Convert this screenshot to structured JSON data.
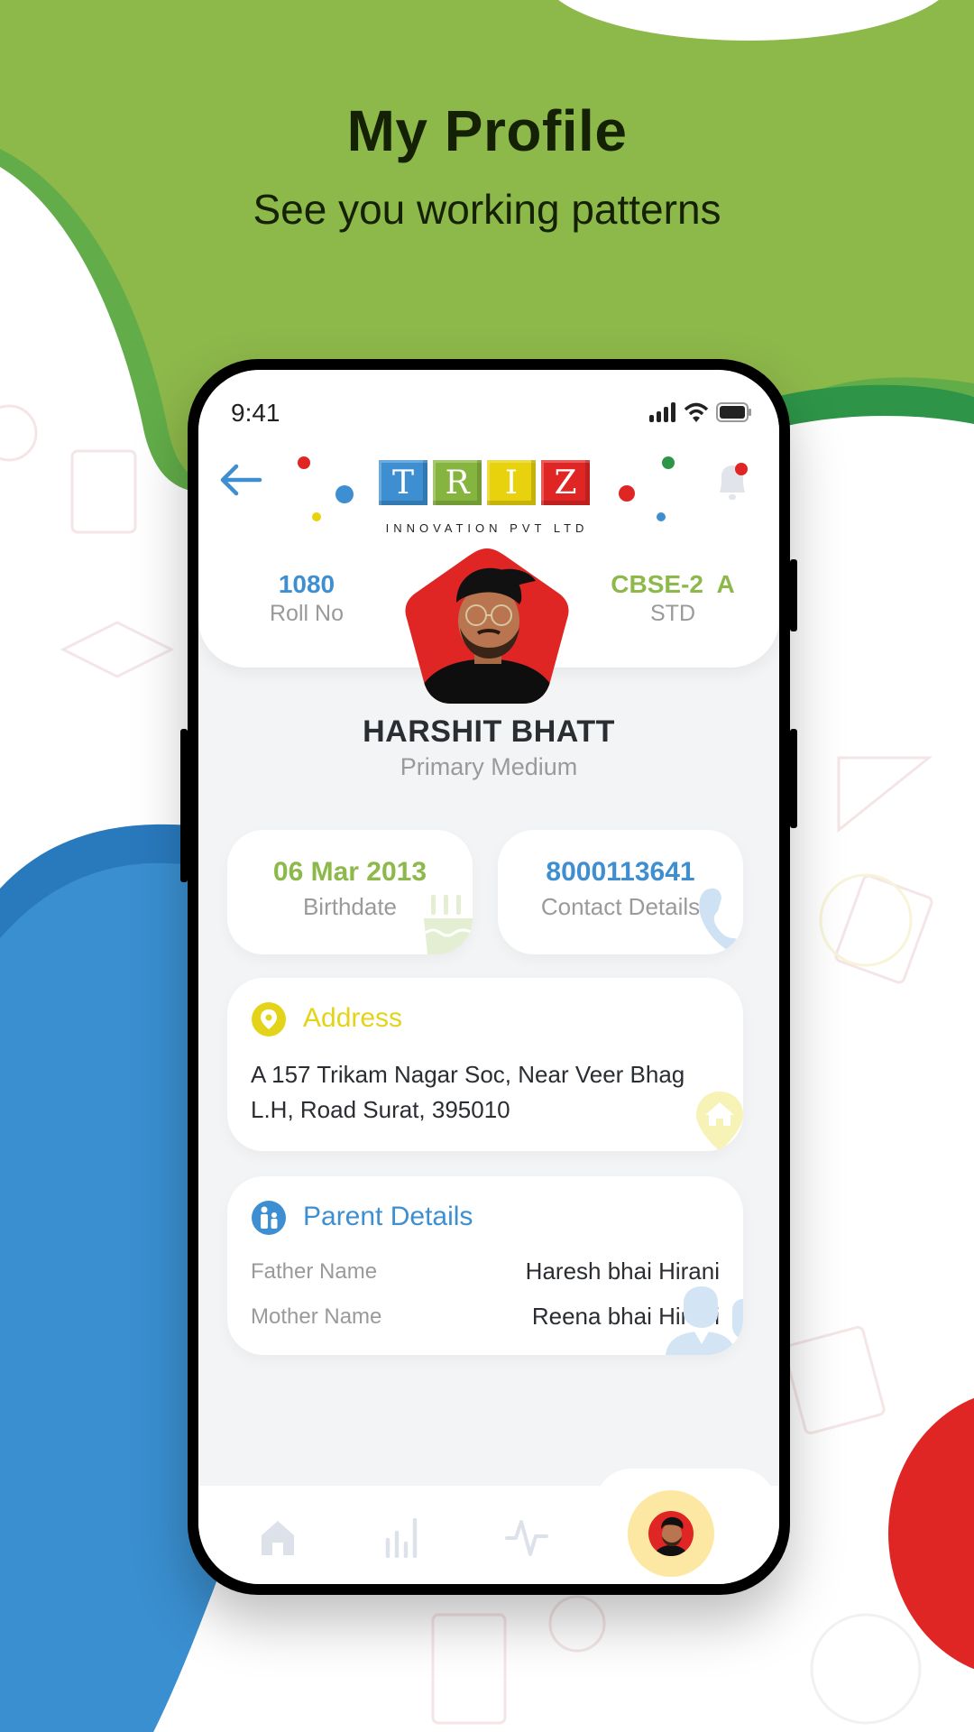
{
  "promo": {
    "title": "My Profile",
    "subtitle": "See you working patterns"
  },
  "status_bar": {
    "time": "9:41",
    "icons": [
      "signal-icon",
      "wifi-icon",
      "battery-icon"
    ]
  },
  "header": {
    "back_icon": "arrow-left-icon",
    "notification_icon": "bell-icon",
    "logo": {
      "letters": [
        "T",
        "R",
        "I",
        "Z"
      ],
      "letter_colors": [
        "#3d8fd1",
        "#86b53f",
        "#e8d20e",
        "#e02525"
      ],
      "subtitle": "INNOVATION PVT LTD"
    }
  },
  "profile": {
    "roll_no": {
      "value": "1080",
      "label": "Roll No"
    },
    "std": {
      "value": "CBSE-2  A",
      "label": "STD"
    },
    "name": "HARSHIT BHATT",
    "medium": "Primary Medium"
  },
  "info_cards": {
    "birthdate": {
      "value": "06 Mar 2013",
      "label": "Birthdate",
      "icon": "cake-icon"
    },
    "contact": {
      "value": "8000113641",
      "label": "Contact Details",
      "icon": "phone-icon"
    }
  },
  "address": {
    "title": "Address",
    "icon": "location-pin-icon",
    "line1": "A 157 Trikam Nagar Soc, Near Veer Bhag",
    "line2": "L.H, Road Surat, 395010"
  },
  "parents": {
    "title": "Parent Details",
    "icon": "family-icon",
    "rows": [
      {
        "label": "Father Name",
        "value": "Haresh bhai Hirani"
      },
      {
        "label": "Mother Name",
        "value": "Reena bhai Hirani"
      }
    ]
  },
  "bottom_nav": {
    "items": [
      {
        "name": "home",
        "icon": "home-icon",
        "active": false
      },
      {
        "name": "stats",
        "icon": "bar-chart-icon",
        "active": false
      },
      {
        "name": "activity",
        "icon": "pulse-icon",
        "active": false
      },
      {
        "name": "profile",
        "icon": "avatar-icon",
        "active": true
      }
    ]
  },
  "colors": {
    "green": "#8db84a",
    "blue": "#3d8fd1",
    "yellow": "#e3d419",
    "red": "#e02525",
    "text_dark": "#2a2d31",
    "text_muted": "#9a9a9a"
  }
}
